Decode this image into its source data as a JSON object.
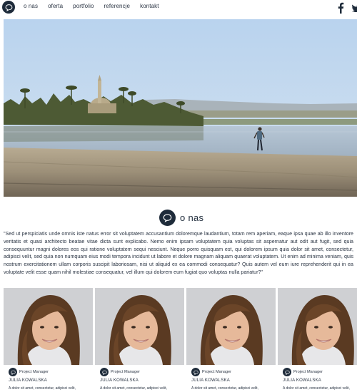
{
  "nav": {
    "logo_icon": "chat-bubble-icon",
    "items": [
      {
        "label": "o nas"
      },
      {
        "label": "oferta"
      },
      {
        "label": "portfolio"
      },
      {
        "label": "referencje"
      },
      {
        "label": "kontakt"
      }
    ],
    "social": [
      {
        "icon": "facebook-icon",
        "glyph": "f"
      },
      {
        "icon": "twitter-icon"
      }
    ]
  },
  "about": {
    "title": "o nas",
    "icon": "chat-bubble-icon",
    "quote": "\"Sed ut perspiciatis unde omnis iste natus error sit voluptatem accusantium doloremque laudantium, totam rem aperiam, eaque ipsa quae ab illo inventore veritatis et quasi architecto beatae vitae dicta sunt explicabo. Nemo enim ipsam voluptatem quia voluptas sit aspernatur aut odit aut fugit, sed quia consequuntur magni dolores eos qui ratione voluptatem sequi nesciunt. Neque porro quisquam est, qui dolorem ipsum quia dolor sit amet, consectetur, adipisci velit, sed quia non numquam eius modi tempora incidunt ut labore et dolore magnam aliquam quaerat voluptatem. Ut enim ad minima veniam, quis nostrum exercitationem ullam corporis suscipit laboriosam, nisi ut aliquid ex ea commodi consequatur? Quis autem vel eum iure reprehenderit qui in ea voluptate velit esse quam nihil molestiae consequatur, vel illum qui dolorem eum fugiat quo voluptas nulla pariatur?\""
  },
  "team": [
    {
      "role": "Project Manager",
      "name": "JULIA KOWALSKA",
      "desc": "A dolor sit amet, consectetur, adipisci velit,"
    },
    {
      "role": "Project Manager",
      "name": "JULIA KOWALSKA",
      "desc": "A dolor sit amet, consectetur, adipisci velit,"
    },
    {
      "role": "Project Manager",
      "name": "JULIA KOWALSKA",
      "desc": "A dolor sit amet, consectetur, adipisci velit,"
    },
    {
      "role": "Project Manager",
      "name": "JULIA KOWALSKA",
      "desc": "A dolor sit amet, consectetur, adipisci velit,"
    }
  ],
  "colors": {
    "accent": "#1e2b3a",
    "text": "#2b3544",
    "background": "#ffffff"
  }
}
